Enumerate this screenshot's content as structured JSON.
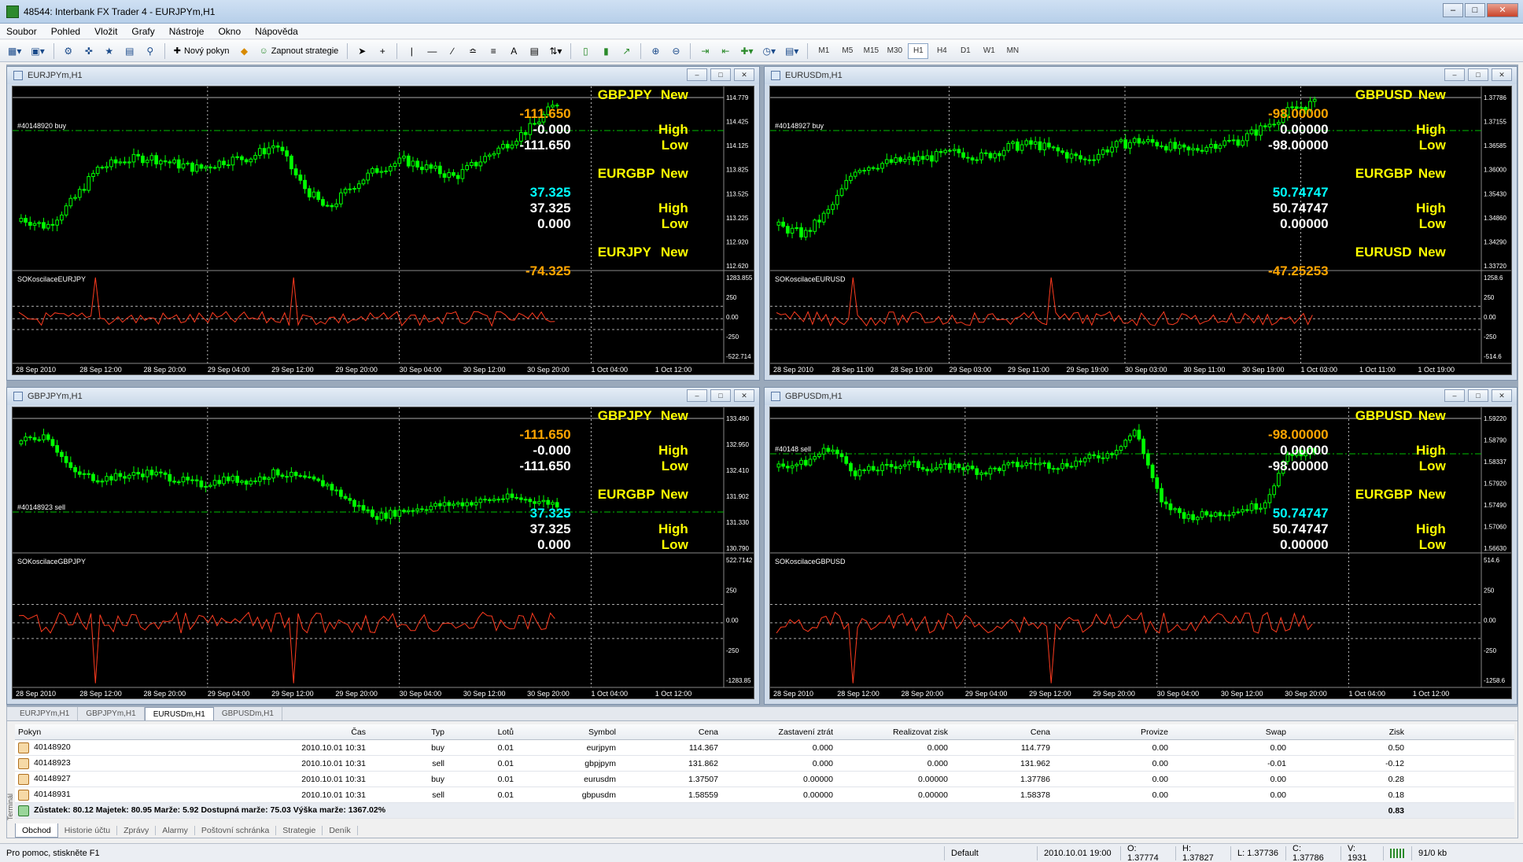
{
  "window": {
    "title": "48544: Interbank FX Trader 4 - EURJPYm,H1"
  },
  "menu": [
    "Soubor",
    "Pohled",
    "Vložit",
    "Grafy",
    "Nástroje",
    "Okno",
    "Nápověda"
  ],
  "toolbar": {
    "new_order": "Nový pokyn",
    "expert": "Zapnout strategie",
    "timeframes": [
      "M1",
      "M5",
      "M15",
      "M30",
      "H1",
      "H4",
      "D1",
      "W1",
      "MN"
    ],
    "active_tf": "H1"
  },
  "colors": {
    "candle": "#00ff00",
    "oscillator": "#ff3b1f",
    "label_yellow": "#ffff00",
    "label_orange": "#ffa500",
    "label_cyan": "#00ffff",
    "label_white": "#ffffff"
  },
  "charts": [
    {
      "id": "eurjpy",
      "title": "EURJPYm,H1",
      "order_label": "#40148920 buy",
      "indicator": "SOKoscilaceEURJPY",
      "price_ticks": [
        "114.779",
        "114.425",
        "114.125",
        "113.825",
        "113.525",
        "113.225",
        "112.920",
        "112.620"
      ],
      "osc_ticks": [
        "1283.855",
        "250",
        "0.00",
        "-250",
        "-522.714"
      ],
      "time_ticks": [
        "28 Sep 2010",
        "28 Sep 12:00",
        "28 Sep 20:00",
        "29 Sep 04:00",
        "29 Sep 12:00",
        "29 Sep 20:00",
        "30 Sep 04:00",
        "30 Sep 12:00",
        "30 Sep 20:00",
        "1 Oct 04:00",
        "1 Oct 12:00"
      ],
      "blocks": [
        {
          "pair": "GBPJPY",
          "status": "New",
          "v1": "-111.650",
          "v2": "-0.000",
          "v3": "-111.650",
          "high": "High",
          "low": "Low"
        },
        {
          "pair": "EURGBP",
          "status": "New",
          "v1": "37.325",
          "v2": "37.325",
          "v3": "0.000",
          "high": "High",
          "low": "Low"
        },
        {
          "pair": "EURJPY",
          "status": "New",
          "v1": "-74.325"
        }
      ]
    },
    {
      "id": "eurusd",
      "title": "EURUSDm,H1",
      "order_label": "#40148927 buy",
      "indicator": "SOKoscilaceEURUSD",
      "price_ticks": [
        "1.37786",
        "1.37155",
        "1.36585",
        "1.36000",
        "1.35430",
        "1.34860",
        "1.34290",
        "1.33720"
      ],
      "osc_ticks": [
        "1258.6",
        "250",
        "0.00",
        "-250",
        "-514.6"
      ],
      "time_ticks": [
        "28 Sep 2010",
        "28 Sep 11:00",
        "28 Sep 19:00",
        "29 Sep 03:00",
        "29 Sep 11:00",
        "29 Sep 19:00",
        "30 Sep 03:00",
        "30 Sep 11:00",
        "30 Sep 19:00",
        "1 Oct 03:00",
        "1 Oct 11:00",
        "1 Oct 19:00"
      ],
      "blocks": [
        {
          "pair": "GBPUSD",
          "status": "New",
          "v1": "-98.00000",
          "v2": "0.00000",
          "v3": "-98.00000",
          "high": "High",
          "low": "Low"
        },
        {
          "pair": "EURGBP",
          "status": "New",
          "v1": "50.74747",
          "v2": "50.74747",
          "v3": "0.00000",
          "high": "High",
          "low": "Low"
        },
        {
          "pair": "EURUSD",
          "status": "New",
          "v1": "-47.25253"
        }
      ]
    },
    {
      "id": "gbpjpy",
      "title": "GBPJPYm,H1",
      "order_label": "#40148923 sell",
      "indicator": "SOKoscilaceGBPJPY",
      "price_ticks": [
        "133.490",
        "132.950",
        "132.410",
        "131.902",
        "131.330",
        "130.790"
      ],
      "osc_ticks": [
        "522.7142",
        "250",
        "0.00",
        "-250",
        "-1283.85"
      ],
      "time_ticks": [
        "28 Sep 2010",
        "28 Sep 12:00",
        "28 Sep 20:00",
        "29 Sep 04:00",
        "29 Sep 12:00",
        "29 Sep 20:00",
        "30 Sep 04:00",
        "30 Sep 12:00",
        "30 Sep 20:00",
        "1 Oct 04:00",
        "1 Oct 12:00"
      ],
      "blocks": [
        {
          "pair": "GBPJPY",
          "status": "New",
          "v1": "-111.650",
          "v2": "-0.000",
          "v3": "-111.650",
          "high": "High",
          "low": "Low"
        },
        {
          "pair": "EURGBP",
          "status": "New",
          "v1": "37.325",
          "v2": "37.325",
          "v3": "0.000",
          "high": "High",
          "low": "Low"
        }
      ]
    },
    {
      "id": "gbpusd",
      "title": "GBPUSDm,H1",
      "order_label": "#40148 sell",
      "indicator": "SOKoscilaceGBPUSD",
      "price_ticks": [
        "1.59220",
        "1.58790",
        "1.58337",
        "1.57920",
        "1.57490",
        "1.57060",
        "1.56630"
      ],
      "osc_ticks": [
        "514.6",
        "250",
        "0.00",
        "-250",
        "-1258.6"
      ],
      "time_ticks": [
        "28 Sep 2010",
        "28 Sep 12:00",
        "28 Sep 20:00",
        "29 Sep 04:00",
        "29 Sep 12:00",
        "29 Sep 20:00",
        "30 Sep 04:00",
        "30 Sep 12:00",
        "30 Sep 20:00",
        "1 Oct 04:00",
        "1 Oct 12:00"
      ],
      "blocks": [
        {
          "pair": "GBPUSD",
          "status": "New",
          "v1": "-98.00000",
          "v2": "0.00000",
          "v3": "-98.00000",
          "high": "High",
          "low": "Low"
        },
        {
          "pair": "EURGBP",
          "status": "New",
          "v1": "50.74747",
          "v2": "50.74747",
          "v3": "0.00000",
          "high": "High",
          "low": "Low"
        }
      ]
    }
  ],
  "chart_tabs": [
    "EURJPYm,H1",
    "GBPJPYm,H1",
    "EURUSDm,H1",
    "GBPUSDm,H1"
  ],
  "active_chart_tab": "EURUSDm,H1",
  "terminal": {
    "label": "Terminál",
    "columns": [
      "Pokyn",
      "Čas",
      "Typ",
      "Lotů",
      "Symbol",
      "Cena",
      "Zastavení ztrát",
      "Realizovat zisk",
      "Cena",
      "Provize",
      "Swap",
      "Zisk"
    ],
    "rows": [
      [
        "40148920",
        "2010.10.01 10:31",
        "buy",
        "0.01",
        "eurjpym",
        "114.367",
        "0.000",
        "0.000",
        "114.779",
        "0.00",
        "0.00",
        "0.50"
      ],
      [
        "40148923",
        "2010.10.01 10:31",
        "sell",
        "0.01",
        "gbpjpym",
        "131.862",
        "0.000",
        "0.000",
        "131.962",
        "0.00",
        "-0.01",
        "-0.12"
      ],
      [
        "40148927",
        "2010.10.01 10:31",
        "buy",
        "0.01",
        "eurusdm",
        "1.37507",
        "0.00000",
        "0.00000",
        "1.37786",
        "0.00",
        "0.00",
        "0.28"
      ],
      [
        "40148931",
        "2010.10.01 10:31",
        "sell",
        "0.01",
        "gbpusdm",
        "1.58559",
        "0.00000",
        "0.00000",
        "1.58378",
        "0.00",
        "0.00",
        "0.18"
      ]
    ],
    "summary": "Zůstatek: 80.12  Majetek: 80.95  Marže: 5.92  Dostupná marže: 75.03  Výška marže: 1367.02%",
    "summary_profit": "0.83",
    "tabs": [
      "Obchod",
      "Historie účtu",
      "Zprávy",
      "Alarmy",
      "Poštovní schránka",
      "Strategie",
      "Deník"
    ],
    "active_tab": "Obchod"
  },
  "status": {
    "help": "Pro pomoc, stiskněte F1",
    "profile": "Default",
    "time": "2010.10.01 19:00",
    "open": "O: 1.37774",
    "high": "H: 1.37827",
    "low": "L: 1.37736",
    "close": "C: 1.37786",
    "volume": "V: 1931",
    "traffic": "91/0 kb"
  }
}
